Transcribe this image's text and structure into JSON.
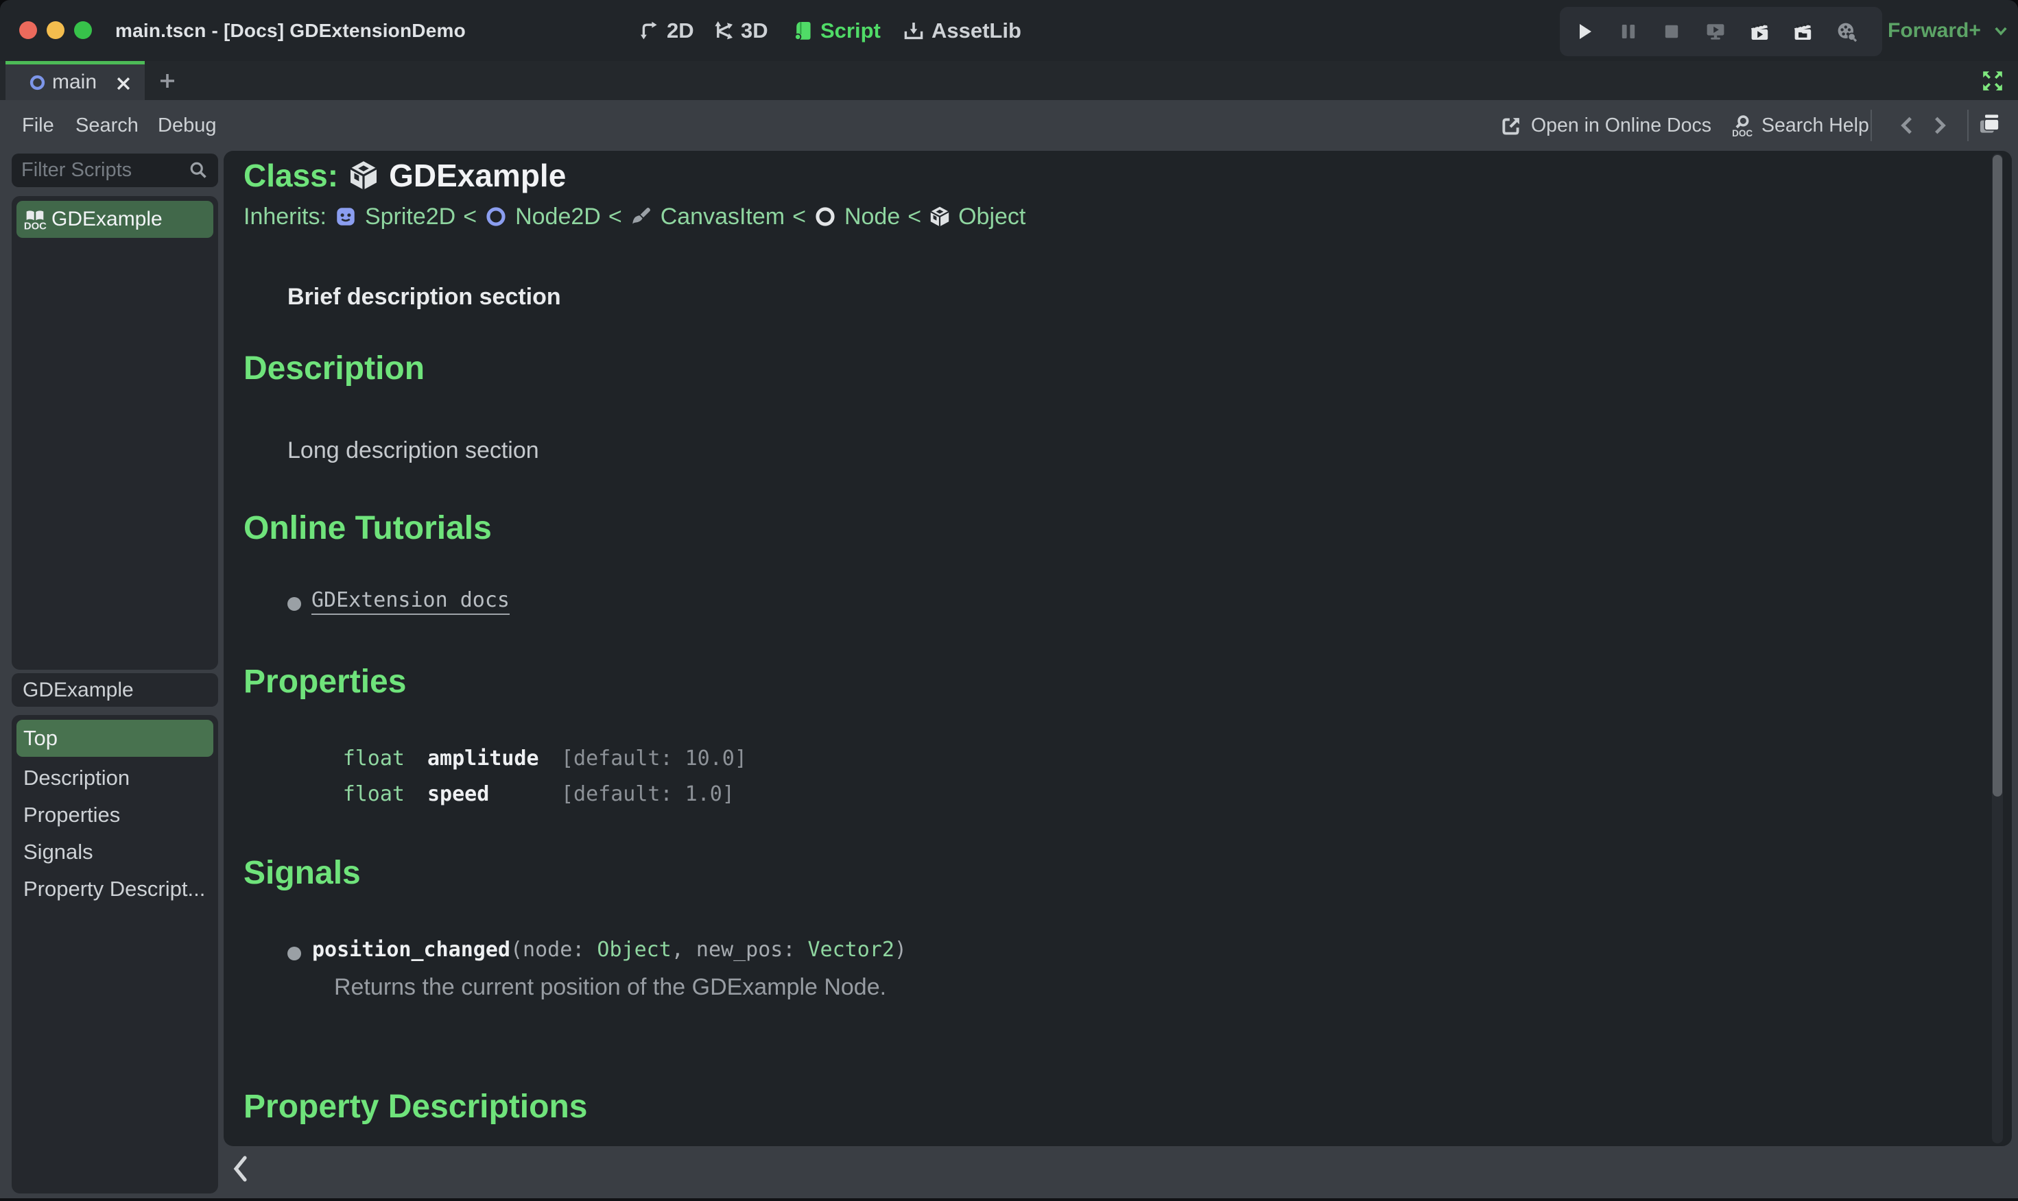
{
  "window": {
    "title": "main.tscn - [Docs] GDExtensionDemo"
  },
  "workspaces": {
    "d2": "2D",
    "d3": "3D",
    "script": "Script",
    "assetlib": "AssetLib"
  },
  "runbar": {
    "profile": "Forward+",
    "icons": [
      "play",
      "pause",
      "stop",
      "play-remote",
      "play-scene",
      "play-custom-scene",
      "movie-maker"
    ]
  },
  "scene_tabs": {
    "active": "main",
    "add_label": "+"
  },
  "menus": {
    "file": "File",
    "search": "Search",
    "debug": "Debug"
  },
  "doc_toolbar": {
    "online_docs": "Open in Online Docs",
    "search_help": "Search Help"
  },
  "scripts_panel": {
    "filter_placeholder": "Filter Scripts",
    "items": [
      {
        "label": "GDExample",
        "selected": true
      }
    ]
  },
  "members_panel": {
    "header": "GDExample",
    "items": [
      "Top",
      "Description",
      "Properties",
      "Signals",
      "Property Descript..."
    ]
  },
  "doc": {
    "class_label": "Class:",
    "class_name": "GDExample",
    "inherits_label": "Inherits:",
    "separator": "<",
    "chain": [
      {
        "name": "Sprite2D",
        "icon": "sprite2d"
      },
      {
        "name": "Node2D",
        "icon": "node2d"
      },
      {
        "name": "CanvasItem",
        "icon": "canvasitem"
      },
      {
        "name": "Node",
        "icon": "node"
      },
      {
        "name": "Object",
        "icon": "object"
      }
    ],
    "brief": "Brief description section",
    "sections": {
      "description": "Description",
      "tutorials": "Online Tutorials",
      "properties": "Properties",
      "signals": "Signals",
      "property_descriptions": "Property Descriptions"
    },
    "long_description": "Long description section",
    "tutorial_link": "GDExtension docs",
    "properties": [
      {
        "type": "float",
        "name": "amplitude",
        "default": "[default: 10.0]"
      },
      {
        "type": "float",
        "name": "speed",
        "default": "[default: 1.0]"
      }
    ],
    "signal": {
      "name": "position_changed",
      "open": "(node: ",
      "arg1_type": "Object",
      "mid": ", new_pos: ",
      "arg2_type": "Vector2",
      "close": ")",
      "description": "Returns the current position of the GDExample Node."
    }
  },
  "colors": {
    "accent_green": "#4dbb57",
    "heading_green": "#6fe37b",
    "link_green": "#8fd6a0",
    "selected_green": "#48724f",
    "background": "#1f2327"
  }
}
